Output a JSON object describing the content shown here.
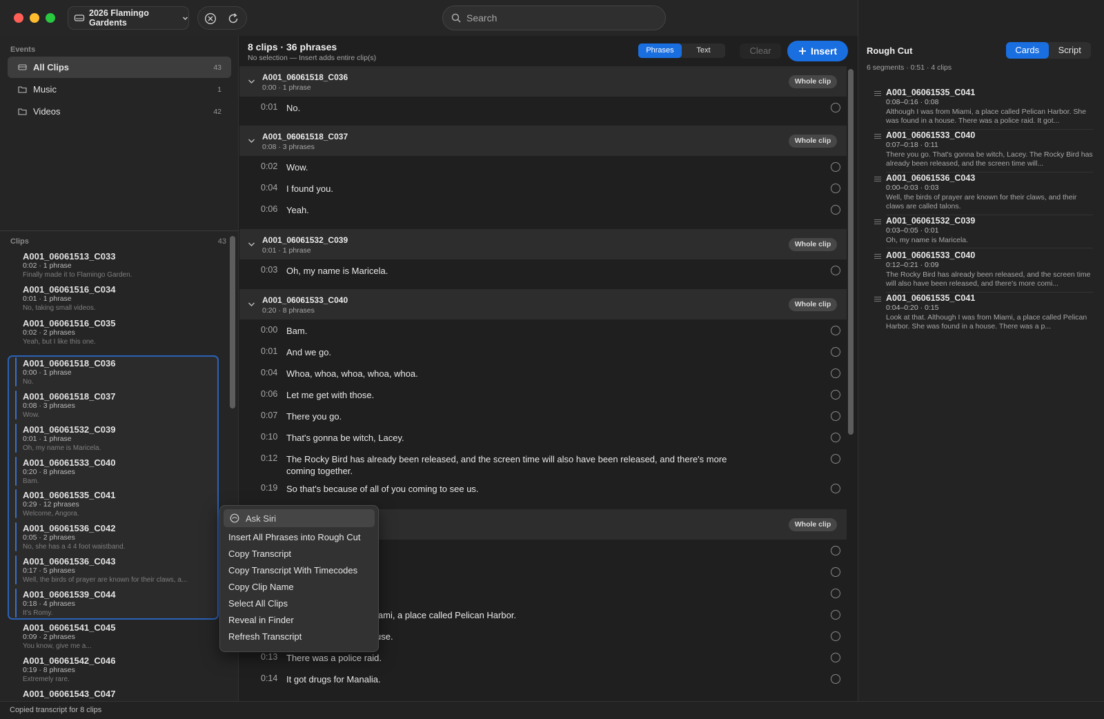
{
  "titlebar": {
    "library_name": "2026 Flamingo Gardents",
    "search_placeholder": "Search"
  },
  "sidebar": {
    "events_title": "Events",
    "events": [
      {
        "label": "All Clips",
        "count": "43",
        "active": true
      },
      {
        "label": "Music",
        "count": "1",
        "active": false
      },
      {
        "label": "Videos",
        "count": "42",
        "active": false
      }
    ],
    "clips_title": "Clips",
    "clips_count": "43",
    "clips": [
      {
        "name": "A001_06061513_C033",
        "meta": "0:02 · 1 phrase",
        "preview": "Finally made it to Flamingo Garden."
      },
      {
        "name": "A001_06061516_C034",
        "meta": "0:01 · 1 phrase",
        "preview": "No, taking small videos."
      },
      {
        "name": "A001_06061516_C035",
        "meta": "0:02 · 2 phrases",
        "preview": "Yeah, but I like this one."
      },
      {
        "name": "A001_06061518_C036",
        "meta": "0:00 · 1 phrase",
        "preview": "No."
      },
      {
        "name": "A001_06061518_C037",
        "meta": "0:08 · 3 phrases",
        "preview": "Wow."
      },
      {
        "name": "A001_06061532_C039",
        "meta": "0:01 · 1 phrase",
        "preview": "Oh, my name is Maricela."
      },
      {
        "name": "A001_06061533_C040",
        "meta": "0:20 · 8 phrases",
        "preview": "Bam."
      },
      {
        "name": "A001_06061535_C041",
        "meta": "0:29 · 12 phrases",
        "preview": "Welcome, Angora."
      },
      {
        "name": "A001_06061536_C042",
        "meta": "0:05 · 2 phrases",
        "preview": "No, she has a 4 4 foot waistband."
      },
      {
        "name": "A001_06061536_C043",
        "meta": "0:17 · 5 phrases",
        "preview": "Well, the birds of prayer are known for their claws, a..."
      },
      {
        "name": "A001_06061539_C044",
        "meta": "0:18 · 4 phrases",
        "preview": "It's Romy."
      },
      {
        "name": "A001_06061541_C045",
        "meta": "0:09 · 2 phrases",
        "preview": "You know, give me a..."
      },
      {
        "name": "A001_06061542_C046",
        "meta": "0:19 · 8 phrases",
        "preview": "Extremely rare."
      },
      {
        "name": "A001_06061543_C047",
        "meta": "",
        "preview": ""
      }
    ]
  },
  "center": {
    "title": "8 clips · 36 phrases",
    "subtitle": "No selection — Insert adds entire clip(s)",
    "seg_phrases": "Phrases",
    "seg_text": "Text",
    "clear_label": "Clear",
    "insert_label": "Insert",
    "whole_clip_label": "Whole clip",
    "groups": [
      {
        "name": "A001_06061518_C036",
        "meta": "0:00 · 1 phrase",
        "phrases": [
          {
            "tc": "0:01",
            "text": "No."
          }
        ]
      },
      {
        "name": "A001_06061518_C037",
        "meta": "0:08 · 3 phrases",
        "phrases": [
          {
            "tc": "0:02",
            "text": "Wow."
          },
          {
            "tc": "0:04",
            "text": "I found you."
          },
          {
            "tc": "0:06",
            "text": "Yeah."
          }
        ]
      },
      {
        "name": "A001_06061532_C039",
        "meta": "0:01 · 1 phrase",
        "phrases": [
          {
            "tc": "0:03",
            "text": "Oh, my name is Maricela."
          }
        ]
      },
      {
        "name": "A001_06061533_C040",
        "meta": "0:20 · 8 phrases",
        "phrases": [
          {
            "tc": "0:00",
            "text": "Bam."
          },
          {
            "tc": "0:01",
            "text": "And we go."
          },
          {
            "tc": "0:04",
            "text": "Whoa, whoa, whoa, whoa, whoa."
          },
          {
            "tc": "0:06",
            "text": "Let me get with those."
          },
          {
            "tc": "0:07",
            "text": "There you go."
          },
          {
            "tc": "0:10",
            "text": "That's gonna be witch, Lacey."
          },
          {
            "tc": "0:12",
            "text": "The Rocky Bird has already been released, and the screen time will also have been released, and there's more coming together."
          },
          {
            "tc": "0:19",
            "text": "So that's because of all of you coming to see us."
          }
        ]
      },
      {
        "name": "",
        "meta": "",
        "phrases": [
          {
            "tc": "",
            "text": ""
          },
          {
            "tc": "",
            "text": ""
          },
          {
            "tc": "",
            "text": ""
          },
          {
            "tc": "",
            "text": "iami, a place called Pelican Harbor."
          },
          {
            "tc": "",
            "text": "use."
          },
          {
            "tc": "0:13",
            "text": "There was a police raid."
          },
          {
            "tc": "0:14",
            "text": "It got drugs for Manalia."
          }
        ]
      }
    ]
  },
  "context_menu": {
    "siri": "Ask Siri",
    "items": [
      "Insert All Phrases into Rough Cut",
      "Copy Transcript",
      "Copy Transcript With Timecodes",
      "Copy Clip Name",
      "Select All Clips",
      "Reveal in Finder",
      "Refresh Transcript"
    ]
  },
  "rough_cut": {
    "title": "Rough Cut",
    "meta": "6 segments · 0:51 · 4 clips",
    "seg_cards": "Cards",
    "seg_script": "Script",
    "cards": [
      {
        "name": "A001_06061535_C041",
        "range": "0:08–0:16 · 0:08",
        "text": "Although I was from Miami, a place called Pelican Harbor. She was found in a house. There was a police raid. It got..."
      },
      {
        "name": "A001_06061533_C040",
        "range": "0:07–0:18 · 0:11",
        "text": "There you go. That's gonna be witch, Lacey. The Rocky Bird has already been released, and the screen time will..."
      },
      {
        "name": "A001_06061536_C043",
        "range": "0:00–0:03 · 0:03",
        "text": "Well, the birds of prayer are known for their claws, and their claws are called talons."
      },
      {
        "name": "A001_06061532_C039",
        "range": "0:03–0:05 · 0:01",
        "text": "Oh, my name is Maricela."
      },
      {
        "name": "A001_06061533_C040",
        "range": "0:12–0:21 · 0:09",
        "text": "The Rocky Bird has already been released, and the screen time will also have been released, and there's more comi..."
      },
      {
        "name": "A001_06061535_C041",
        "range": "0:04–0:20 · 0:15",
        "text": "Look at that. Although I was from Miami, a place called Pelican Harbor. She was found in a house. There was a p..."
      }
    ]
  },
  "status": "Copied transcript for 8 clips",
  "colors": {
    "accent": "#1a6fe0",
    "selection_border": "#2b62b8",
    "background": "#1e1e1e"
  }
}
